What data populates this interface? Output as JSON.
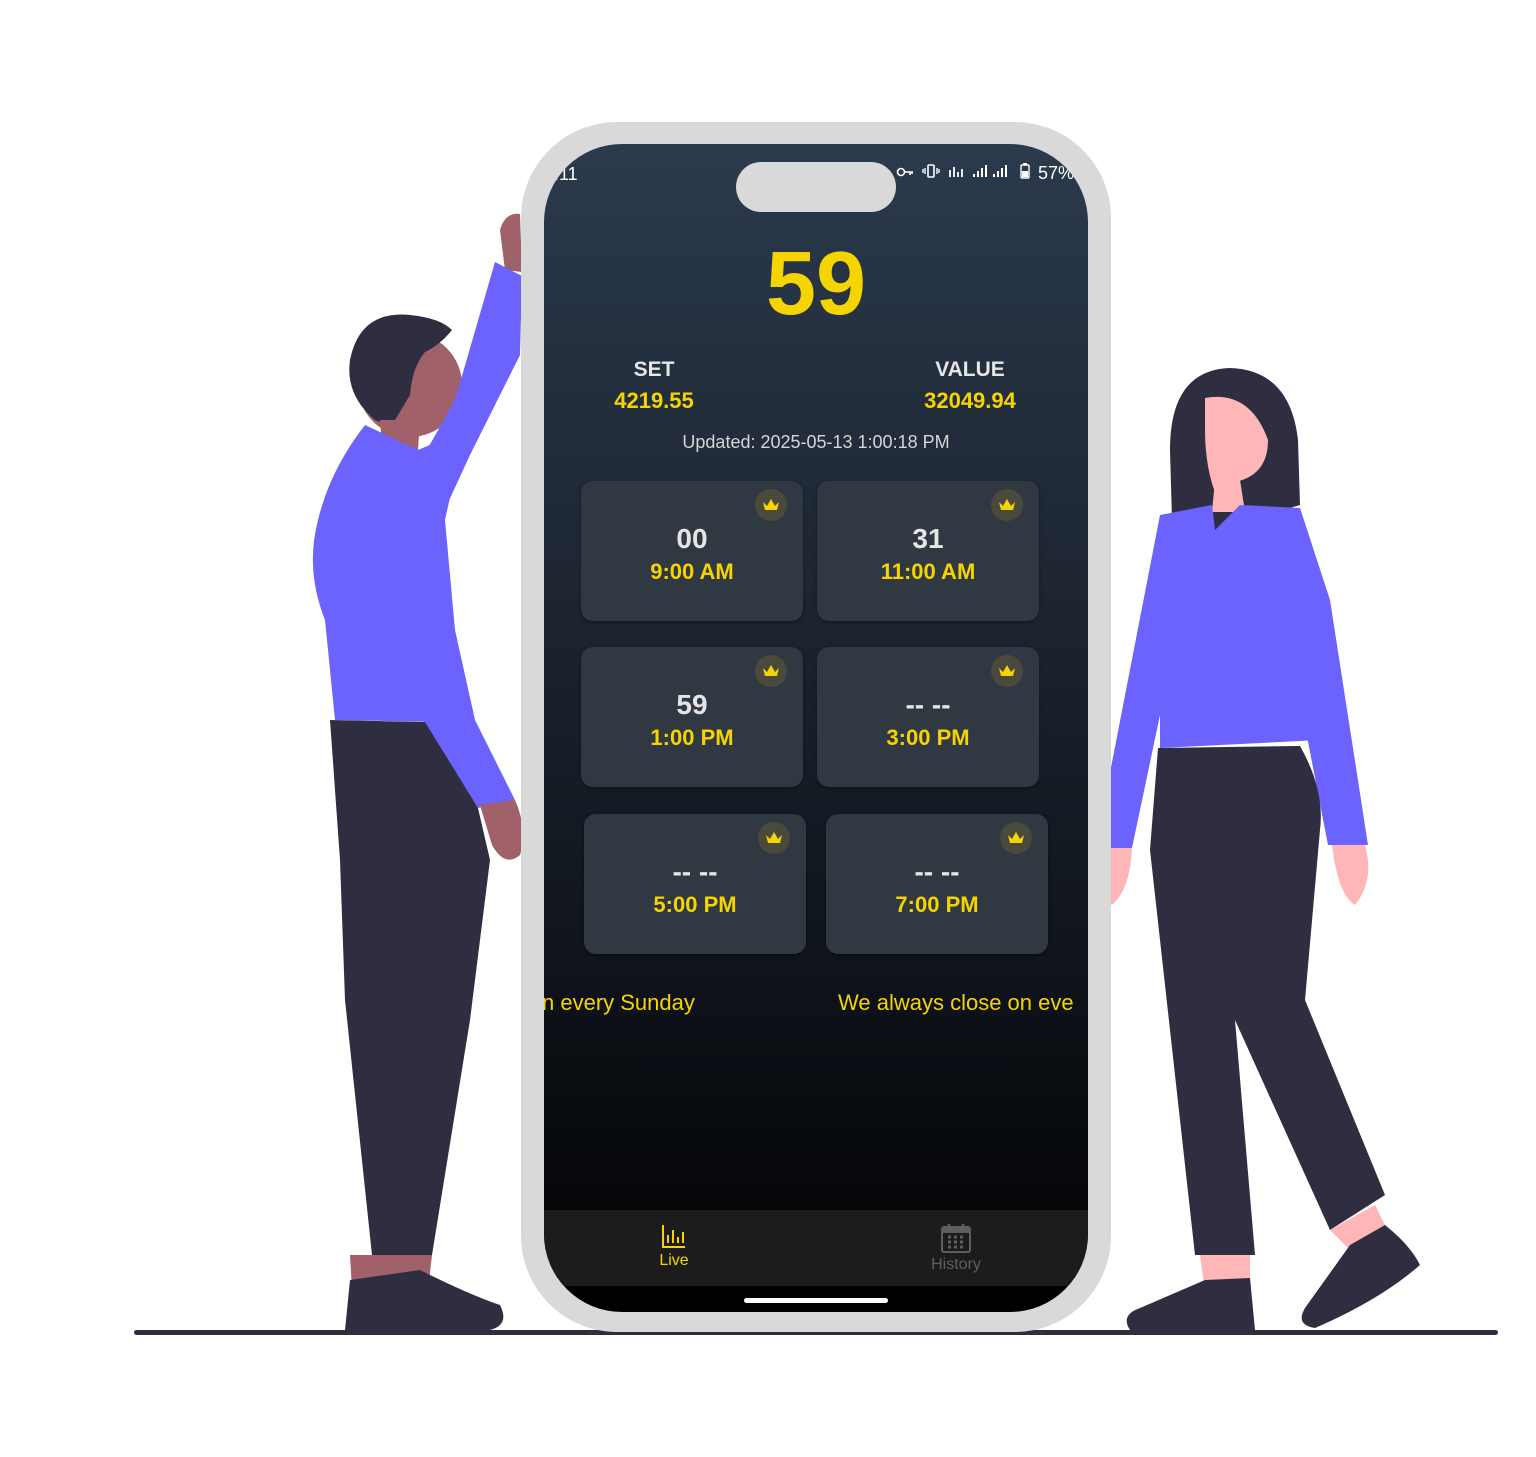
{
  "colors": {
    "accent": "#f6d400",
    "card": "#303842",
    "figure_shirt": "#6c63ff",
    "figure_pants": "#2f2e41",
    "phone_frame": "#d9d9d9"
  },
  "status_bar": {
    "time": ":11",
    "battery": "57%",
    "icons": [
      "key-icon",
      "vibrate-icon",
      "data-icon",
      "signal-icon",
      "battery-icon"
    ]
  },
  "main": {
    "big_number": "59",
    "set_label": "SET",
    "set_value": "4219.55",
    "value_label": "VALUE",
    "value_value": "32049.94",
    "updated": "Updated: 2025-05-13 1:00:18 PM"
  },
  "cards": [
    {
      "number": "00",
      "time": "9:00 AM",
      "icon": "crown-icon"
    },
    {
      "number": "31",
      "time": "11:00 AM",
      "icon": "crown-icon"
    },
    {
      "number": "59",
      "time": "1:00 PM",
      "icon": "crown-icon"
    },
    {
      "number": "-- --",
      "time": "3:00 PM",
      "icon": "crown-icon"
    },
    {
      "number": "-- --",
      "time": "5:00 PM",
      "icon": "crown-icon"
    },
    {
      "number": "-- --",
      "time": "7:00 PM",
      "icon": "crown-icon"
    }
  ],
  "ticker": {
    "part1": "n every Sunday",
    "part2": "We always close on eve"
  },
  "nav": {
    "live_label": "Live",
    "history_label": "History"
  }
}
